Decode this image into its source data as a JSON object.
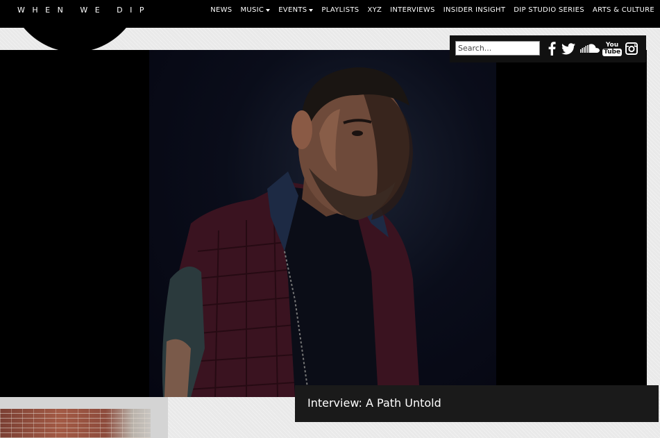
{
  "brand": {
    "logo": "WHEN WE DIP"
  },
  "nav": {
    "items": [
      {
        "label": "NEWS",
        "dropdown": false
      },
      {
        "label": "MUSIC",
        "dropdown": true
      },
      {
        "label": "EVENTS",
        "dropdown": true
      },
      {
        "label": "PLAYLISTS",
        "dropdown": false
      },
      {
        "label": "XYZ",
        "dropdown": false
      },
      {
        "label": "INTERVIEWS",
        "dropdown": false
      },
      {
        "label": "INSIDER INSIGHT",
        "dropdown": false
      },
      {
        "label": "DIP STUDIO SERIES",
        "dropdown": false
      },
      {
        "label": "ARTS & CULTURE",
        "dropdown": false
      }
    ]
  },
  "search": {
    "placeholder": "Search..."
  },
  "social": {
    "icons": [
      "facebook-icon",
      "twitter-icon",
      "soundcloud-icon",
      "youtube-icon",
      "instagram-icon"
    ],
    "youtube_text": [
      "You",
      "Tube"
    ]
  },
  "hero": {
    "caption": "Interview: A Path Untold"
  },
  "colors": {
    "header_bg": "#000000",
    "panel_bg": "#111111",
    "caption_bg": "#1a1a1a",
    "page_bg": "#e9e9e9",
    "text": "#ffffff"
  }
}
